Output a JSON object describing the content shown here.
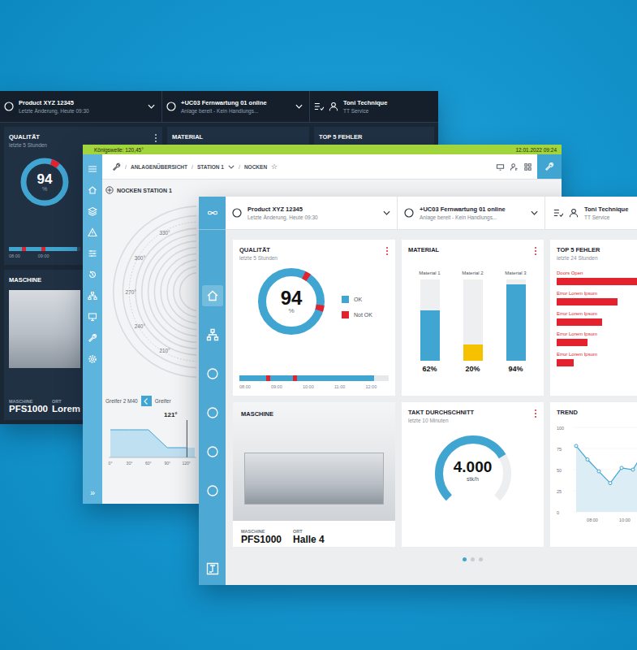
{
  "back_window": {
    "header": {
      "product": {
        "title": "Product XYZ 12345",
        "subtitle": "Letzte Änderung, Heute 09:30"
      },
      "remote": {
        "title": "+UC03 Fernwartung 01 online",
        "subtitle": "Anlage bereit - Kein Handlungs..."
      },
      "user": {
        "name": "Toni Technique",
        "role": "TT Service"
      }
    },
    "quality": {
      "title": "QUALITÄT",
      "subtitle": "letzte 5 Stunden",
      "value": "94",
      "unit": "%",
      "level": 0.94,
      "faults": [
        0.05
      ],
      "timeline": {
        "level": 0.95,
        "faults": [
          0.18,
          0.45
        ],
        "labels": [
          "08:00",
          "09:00"
        ]
      }
    },
    "material": {
      "title": "MATERIAL"
    },
    "errors": {
      "title": "TOP 5 FEHLER"
    },
    "machine": {
      "title": "MASCHINE",
      "machine_label": "MASCHINE",
      "machine": "PFS1000",
      "location_label": "ORT",
      "location": "Lorem"
    }
  },
  "station_window": {
    "status": {
      "text": "Königswelle: 120,45°",
      "datetime": "12.01.2022 09:24"
    },
    "breadcrumb": {
      "separator": "/",
      "items": [
        {
          "label": "ANLAGENÜBERSICHT",
          "dropdown": false
        },
        {
          "label": "STATION 1",
          "dropdown": true
        },
        {
          "label": "NOCKEN",
          "dropdown": false
        }
      ],
      "favorite": "☆"
    },
    "sidebar": {
      "items": [
        {
          "kind": "menu"
        },
        {
          "kind": "home"
        },
        {
          "kind": "layers"
        },
        {
          "kind": "warning"
        },
        {
          "kind": "sliders"
        },
        {
          "kind": "history"
        },
        {
          "kind": "hierarchy"
        },
        {
          "kind": "monitor"
        },
        {
          "kind": "wrench"
        },
        {
          "kind": "gear"
        }
      ],
      "expand": "»"
    },
    "title": "NOCKEN STATION 1",
    "dial": {
      "labels": [
        {
          "text": "330°",
          "angle": 330
        },
        {
          "text": "300°",
          "angle": 300
        },
        {
          "text": "270°",
          "angle": 270
        },
        {
          "text": "240°",
          "angle": 240
        },
        {
          "text": "210°",
          "angle": 210
        }
      ]
    },
    "gripper": {
      "label": "Greifer 2 M40",
      "next": "Greifer",
      "angle": "121°",
      "marker": 121
    },
    "profile": {
      "values": [
        34,
        34,
        34,
        12,
        12
      ],
      "ticks": [
        {
          "text": "0°",
          "value": 0
        },
        {
          "text": "30°",
          "value": 30
        },
        {
          "text": "60°",
          "value": 60
        },
        {
          "text": "90°",
          "value": 90
        },
        {
          "text": "120°",
          "value": 120
        }
      ]
    }
  },
  "dashboard": {
    "header": {
      "product": {
        "title": "Product XYZ 12345",
        "subtitle": "Letzte Änderung, Heute 09:30"
      },
      "remote": {
        "title": "+UC03 Fernwartung 01 online",
        "subtitle": "Anlage bereit - Kein Handlungs..."
      },
      "user": {
        "name": "Toni Technique",
        "role": "TT Service"
      }
    },
    "sidebar": {
      "items": [
        {
          "kind": "home",
          "selected": true
        },
        {
          "kind": "network",
          "selected": false
        },
        {
          "kind": "circle",
          "selected": false
        },
        {
          "kind": "circle",
          "selected": false
        },
        {
          "kind": "circle",
          "selected": false
        },
        {
          "kind": "circle",
          "selected": false
        }
      ]
    },
    "quality": {
      "title": "QUALITÄT",
      "subtitle": "letzte 5 Stunden",
      "value": "94",
      "unit": "%",
      "level": 0.94,
      "faults": [
        0.07,
        0.27
      ],
      "legend": [
        {
          "label": "OK",
          "color": "#41a5d2"
        },
        {
          "label": "Not OK",
          "color": "#e3222e"
        }
      ],
      "timeline": {
        "level": 0.9,
        "faults": [
          0.18,
          0.36
        ],
        "labels": [
          "08:00",
          "09:00",
          "10:00",
          "11:00",
          "12:00"
        ]
      }
    },
    "material": {
      "title": "MATERIAL",
      "items": [
        {
          "label": "Material 1",
          "value": "62%",
          "level": 0.62,
          "color": "#41a5d2"
        },
        {
          "label": "Material 2",
          "value": "20%",
          "level": 0.2,
          "color": "#f6c200"
        },
        {
          "label": "Material 3",
          "value": "94%",
          "level": 0.94,
          "color": "#41a5d2"
        }
      ]
    },
    "errors": {
      "title": "TOP 5 FEHLER",
      "subtitle": "letzte 24 Stunden",
      "items": [
        {
          "label": "Doors Open",
          "level": 1
        },
        {
          "label": "Error Lorem Ipsum",
          "level": 0.46
        },
        {
          "label": "Error Lorem Ipsum",
          "level": 0.34
        },
        {
          "label": "Error Lorem Ipsum",
          "level": 0.23
        },
        {
          "label": "Error Lorem Ipsum",
          "level": 0.13
        }
      ]
    },
    "machine": {
      "title": "MASCHINE",
      "machine_label": "MASCHINE",
      "machine": "PFS1000",
      "location_label": "ORT",
      "location": "Halle 4"
    },
    "cycle": {
      "title": "TAKT DURCHSCHNITT",
      "subtitle": "letzte 10 Minuten",
      "value": "4.000",
      "unit": "stk/h",
      "level": 0.72
    },
    "trend": {
      "title": "TREND",
      "y_ticks": [
        "100",
        "75",
        "50",
        "25",
        "0"
      ],
      "x_ticks": [
        "08:00",
        "10:00"
      ],
      "values": [
        78,
        62,
        48,
        34,
        52,
        50,
        72,
        88,
        80,
        70,
        75
      ]
    },
    "pages": [
      {
        "selected": true
      },
      {
        "selected": false
      },
      {
        "selected": false
      }
    ]
  }
}
